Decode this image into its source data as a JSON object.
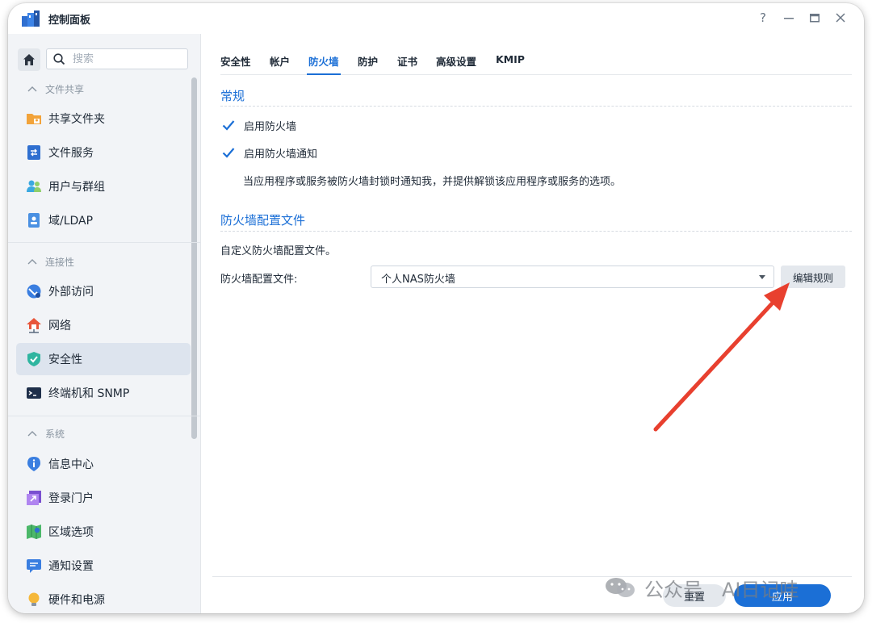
{
  "window": {
    "title": "控制面板",
    "controls": {
      "help": "?",
      "minimize": "—",
      "maximize": "▭",
      "close": "✕"
    }
  },
  "sidebar": {
    "search_placeholder": "搜索",
    "sections": [
      {
        "header": "文件共享",
        "items": [
          {
            "label": "共享文件夹",
            "icon": "shared-folder-icon",
            "active": false
          },
          {
            "label": "文件服务",
            "icon": "file-services-icon",
            "active": false
          },
          {
            "label": "用户与群组",
            "icon": "users-groups-icon",
            "active": false
          },
          {
            "label": "域/LDAP",
            "icon": "domain-ldap-icon",
            "active": false
          }
        ]
      },
      {
        "header": "连接性",
        "items": [
          {
            "label": "外部访问",
            "icon": "external-access-icon",
            "active": false
          },
          {
            "label": "网络",
            "icon": "network-icon",
            "active": false
          },
          {
            "label": "安全性",
            "icon": "security-shield-icon",
            "active": true
          },
          {
            "label": "终端机和 SNMP",
            "icon": "terminal-icon",
            "active": false
          }
        ]
      },
      {
        "header": "系统",
        "items": [
          {
            "label": "信息中心",
            "icon": "info-center-icon",
            "active": false
          },
          {
            "label": "登录门户",
            "icon": "login-portal-icon",
            "active": false
          },
          {
            "label": "区域选项",
            "icon": "regional-options-icon",
            "active": false
          },
          {
            "label": "通知设置",
            "icon": "notification-icon",
            "active": false
          },
          {
            "label": "硬件和电源",
            "icon": "hardware-power-icon",
            "active": false
          }
        ]
      }
    ]
  },
  "tabs": [
    {
      "label": "安全性",
      "active": false
    },
    {
      "label": "帐户",
      "active": false
    },
    {
      "label": "防火墙",
      "active": true
    },
    {
      "label": "防护",
      "active": false
    },
    {
      "label": "证书",
      "active": false
    },
    {
      "label": "高级设置",
      "active": false
    },
    {
      "label": "KMIP",
      "active": false
    }
  ],
  "general": {
    "title": "常规",
    "enable_firewall": {
      "label": "启用防火墙",
      "checked": true
    },
    "enable_notify": {
      "label": "启用防火墙通知",
      "checked": true
    },
    "notify_description": "当应用程序或服务被防火墙封锁时通知我，并提供解锁该应用程序或服务的选项。"
  },
  "profile": {
    "title": "防火墙配置文件",
    "description": "自定义防火墙配置文件。",
    "field_label": "防火墙配置文件:",
    "selected": "个人NAS防火墙",
    "edit_button": "编辑规则"
  },
  "footer": {
    "reset": "重置",
    "apply": "应用"
  },
  "watermark": {
    "part_a": "公众号",
    "part_b": "AI日记哇"
  },
  "colors": {
    "accent": "#1b6fd6",
    "arrow": "#e8402f",
    "sidebar_bg": "#f2f4f7",
    "active_item_bg": "#dde4ee"
  }
}
